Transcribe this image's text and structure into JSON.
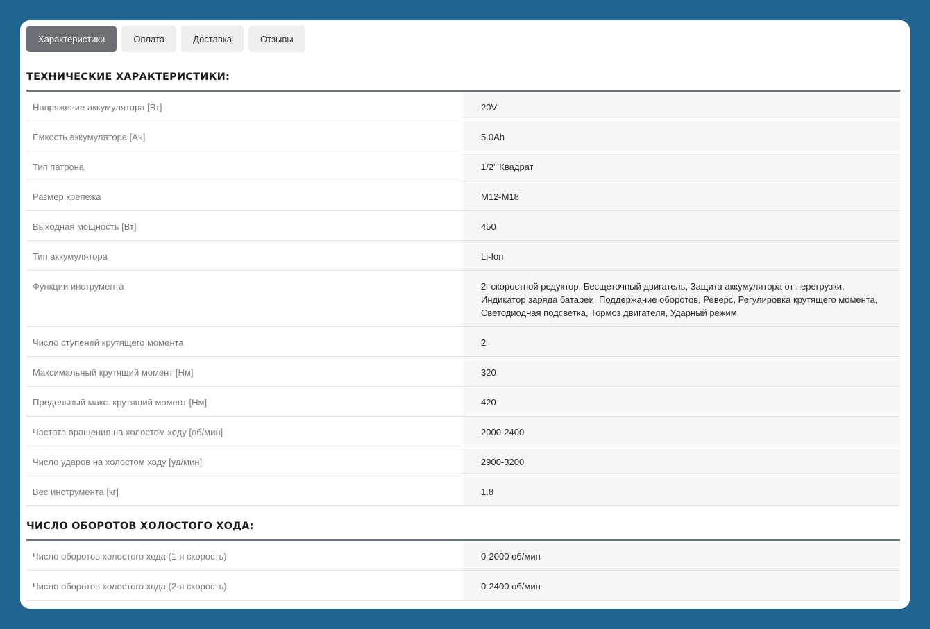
{
  "tabs": [
    {
      "label": "Характеристики",
      "active": true
    },
    {
      "label": "Оплата",
      "active": false
    },
    {
      "label": "Доставка",
      "active": false
    },
    {
      "label": "Отзывы",
      "active": false
    }
  ],
  "sections": [
    {
      "title": "ТЕХНИЧЕСКИЕ ХАРАКТЕРИСТИКИ:",
      "rows": [
        {
          "name": "Напряжение аккумулятора [Вт]",
          "value": "20V"
        },
        {
          "name": "Ёмкость аккумулятора [Ач]",
          "value": "5.0Ah"
        },
        {
          "name": "Тип патрона",
          "value": "1/2\" Квадрат"
        },
        {
          "name": "Размер крепежа",
          "value": "M12-M18"
        },
        {
          "name": "Выходная мощность [Вт]",
          "value": "450"
        },
        {
          "name": "Тип аккумулятора",
          "value": "Li-Ion"
        },
        {
          "name": "Функции инструмента",
          "value": "2–скоростной редуктор, Бесщеточный двигатель, Защита аккумулятора от перегрузки, Индикатор заряда батареи, Поддержание оборотов, Реверс, Регулировка крутящего момента, Светодиодная подсветка, Тормоз двигателя, Ударный режим"
        },
        {
          "name": "Число ступеней крутящего момента",
          "value": "2"
        },
        {
          "name": "Максимальный крутящий момент [Нм]",
          "value": "320"
        },
        {
          "name": "Предельный макс. крутящий момент [Нм]",
          "value": "420"
        },
        {
          "name": "Частота вращения на холостом ходу [об/мин]",
          "value": "2000-2400"
        },
        {
          "name": "Число ударов на холостом ходу [уд/мин]",
          "value": "2900-3200"
        },
        {
          "name": "Вес инструмента [кг]",
          "value": "1.8"
        }
      ]
    },
    {
      "title": "ЧИСЛО ОБОРОТОВ ХОЛОСТОГО ХОДА:",
      "rows": [
        {
          "name": "Число оборотов холостого хода (1-я скорость)",
          "value": "0-2000 об/мин"
        },
        {
          "name": "Число оборотов холостого хода (2-я скорость)",
          "value": "0-2400 об/мин"
        }
      ]
    }
  ],
  "colors": {
    "page_background": "#1e6590",
    "active_tab": "#6b6f73",
    "inactive_tab": "#eeeeef",
    "rule": "#6d7277",
    "value_cell": "#f7f7f9"
  }
}
